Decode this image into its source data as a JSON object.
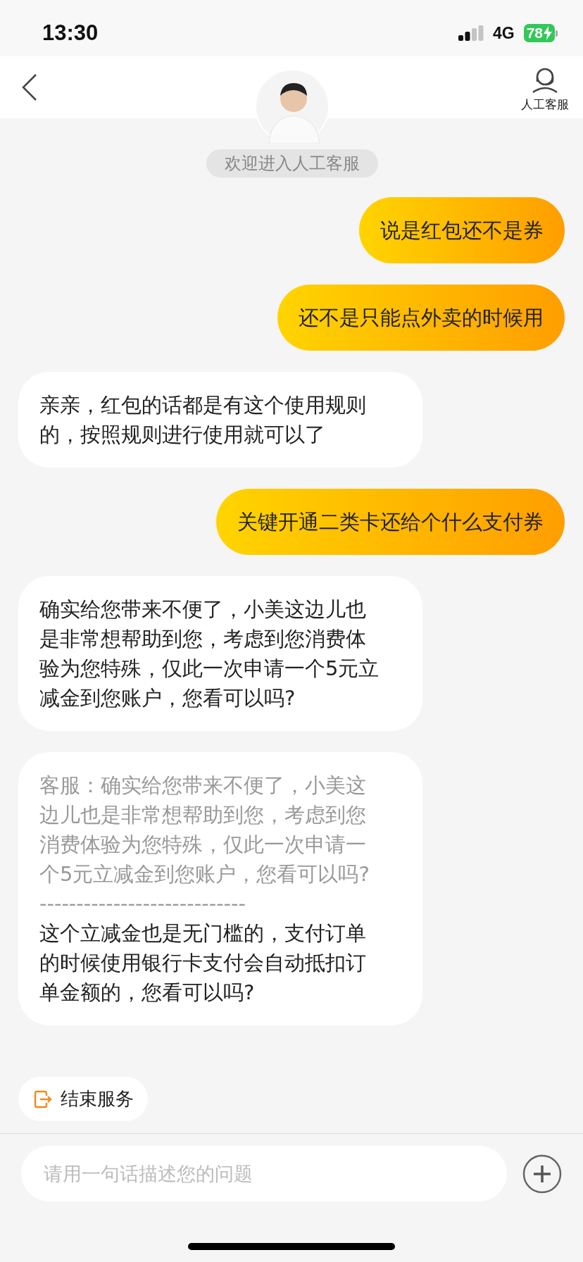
{
  "status_bar": {
    "time": "13:30",
    "network": "4G",
    "battery": "78",
    "charging": true
  },
  "header": {
    "agent_label": "人工客服"
  },
  "welcome": "欢迎进入人工客服",
  "messages": [
    {
      "kind": "user",
      "text": "说是红包还不是券"
    },
    {
      "kind": "user",
      "text": "还不是只能点外卖的时候用"
    },
    {
      "kind": "agent",
      "text": "亲亲，红包的话都是有这个使用规则的，按照规则进行使用就可以了"
    },
    {
      "kind": "user",
      "text": "关键开通二类卡还给个什么支付券"
    },
    {
      "kind": "agent",
      "text": "确实给您带来不便了，小美这边儿也是非常想帮助到您，考虑到您消费体验为您特殊，仅此一次申请一个5元立减金到您账户，您看可以吗?"
    },
    {
      "kind": "agent",
      "quote": "客服：确实给您带来不便了，小美这边儿也是非常想帮助到您，考虑到您消费体验为您特殊，仅此一次申请一个5元立减金到您账户，您看可以吗?",
      "separator": "----------------------------",
      "text": "这个立减金也是无门槛的，支付订单的时候使用银行卡支付会自动抵扣订单金额的，您看可以吗?"
    }
  ],
  "end_service": "结束服务",
  "input": {
    "placeholder": "请用一句话描述您的问题"
  }
}
